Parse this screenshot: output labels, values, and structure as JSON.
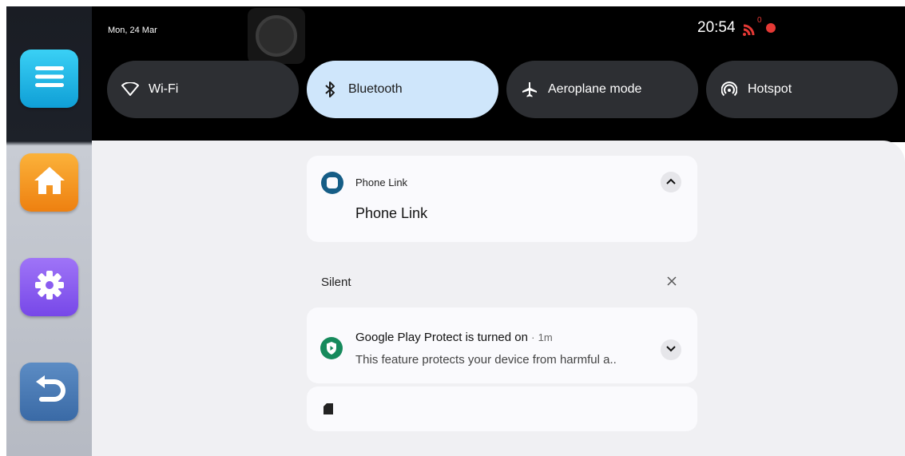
{
  "status": {
    "date": "Mon, 24 Mar",
    "time": "20:54",
    "cast_count": "0"
  },
  "quick_tiles": [
    {
      "label": "Wi-Fi",
      "icon": "wifi-icon",
      "active": false
    },
    {
      "label": "Bluetooth",
      "icon": "bluetooth-icon",
      "active": true
    },
    {
      "label": "Aeroplane mode",
      "icon": "airplane-icon",
      "active": false
    },
    {
      "label": "Hotspot",
      "icon": "hotspot-icon",
      "active": false
    }
  ],
  "sidebar": [
    {
      "icon": "menu-icon",
      "color": "#1fb6e8"
    },
    {
      "icon": "home-icon",
      "color": "#f39a1c"
    },
    {
      "icon": "settings-icon",
      "color": "#8a5cf0"
    },
    {
      "icon": "back-icon",
      "color": "#4a78b0"
    }
  ],
  "notifications": {
    "phone_link": {
      "app": "Phone Link",
      "title": "Phone Link"
    },
    "silent_header": "Silent",
    "play_protect": {
      "title": "Google Play Protect is turned on",
      "separator": "·",
      "time": "1m",
      "body": "This feature protects your device from harmful a.."
    }
  },
  "colors": {
    "accent": "#cfe6fb",
    "panel_bg": "#f0f0f3",
    "play_green": "#168a5c",
    "phone_link_blue": "#155d86"
  }
}
